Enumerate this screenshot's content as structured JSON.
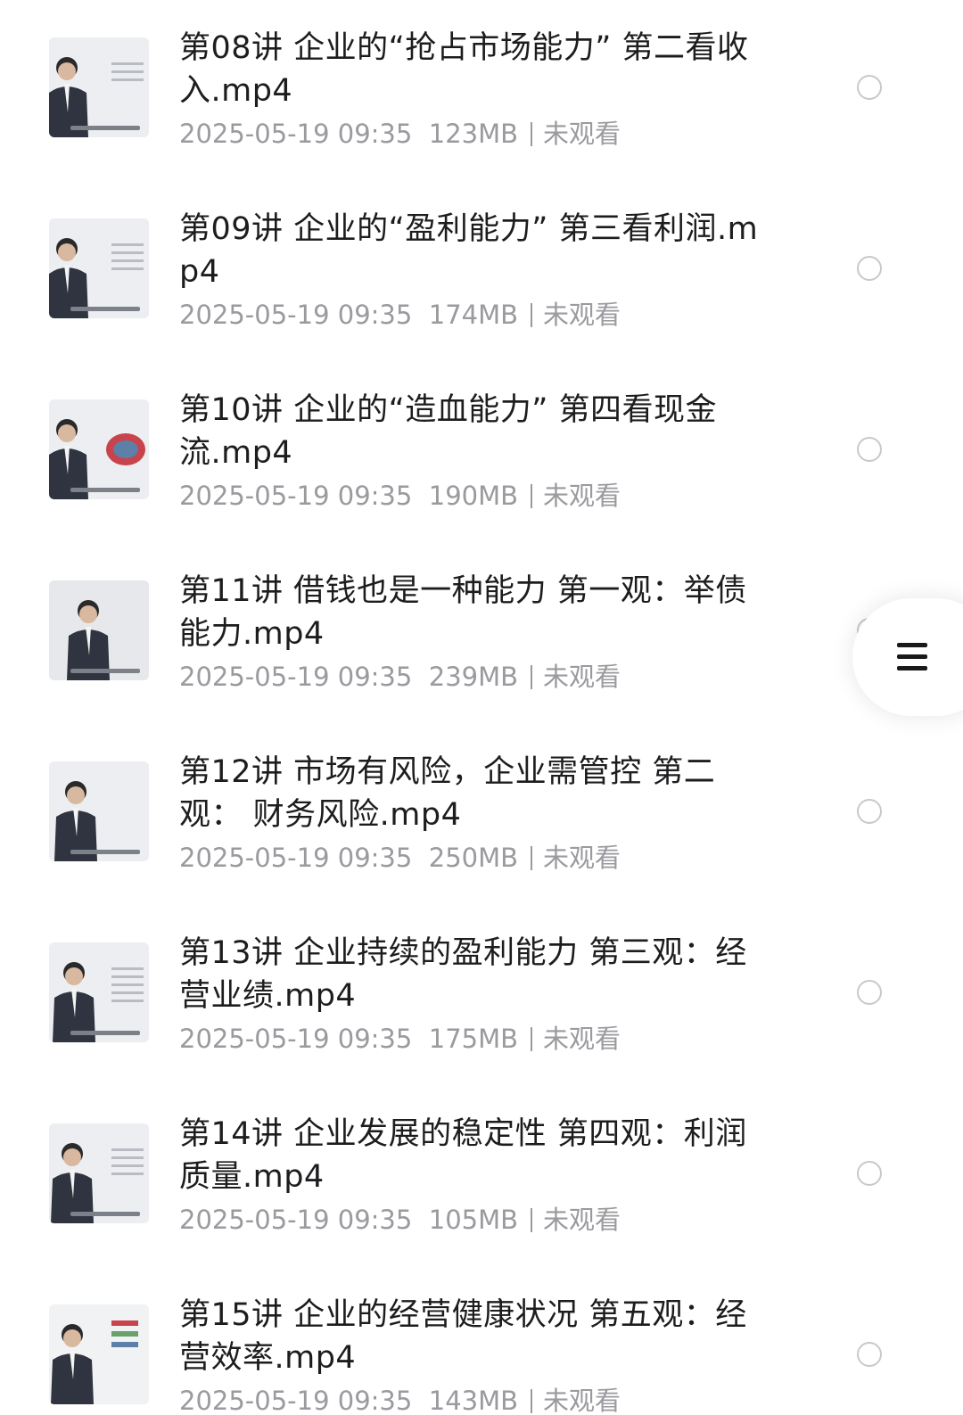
{
  "colors": {
    "title_text": "#1d1d1f",
    "meta_text": "#9a9a9f",
    "radio_border": "#c9c9cc"
  },
  "files": [
    {
      "title": "第08讲 企业的“抢占市场能力” 第二看收入.mp4",
      "date": "2025-05-19 09:35",
      "size": "123MB",
      "status": "未观看"
    },
    {
      "title": "第09讲 企业的“盈利能力” 第三看利润.mp4",
      "date": "2025-05-19 09:35",
      "size": "174MB",
      "status": "未观看"
    },
    {
      "title": "第10讲 企业的“造血能力” 第四看现金流.mp4",
      "date": "2025-05-19 09:35",
      "size": "190MB",
      "status": "未观看"
    },
    {
      "title": "第11讲 借钱也是一种能力 第一观：举债能力.mp4",
      "date": "2025-05-19 09:35",
      "size": "239MB",
      "status": "未观看"
    },
    {
      "title": "第12讲 市场有风险，企业需管控 第二观： 财务风险.mp4",
      "date": "2025-05-19 09:35",
      "size": "250MB",
      "status": "未观看"
    },
    {
      "title": "第13讲 企业持续的盈利能力 第三观：经营业绩.mp4",
      "date": "2025-05-19 09:35",
      "size": "175MB",
      "status": "未观看"
    },
    {
      "title": "第14讲 企业发展的稳定性 第四观：利润质量.mp4",
      "date": "2025-05-19 09:35",
      "size": "105MB",
      "status": "未观看"
    },
    {
      "title": "第15讲 企业的经营健康状况 第五观：经营效率.mp4",
      "date": "2025-05-19 09:35",
      "size": "143MB",
      "status": "未观看"
    }
  ],
  "menu_button": {
    "icon": "hamburger-menu-icon"
  }
}
